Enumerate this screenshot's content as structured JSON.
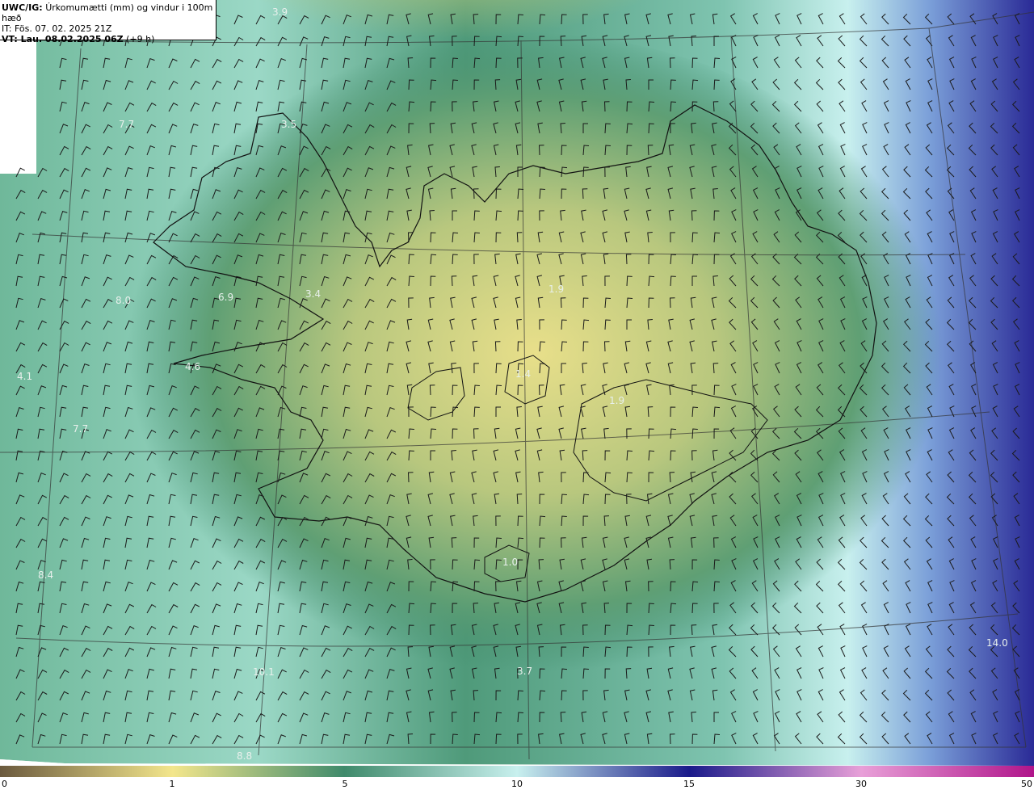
{
  "header": {
    "model": "UWC/IG:",
    "title": "Úrkomumætti (mm) og vindur i 100m hæð",
    "it_line": "IT: Fös. 07. 02. 2025 21Z",
    "vt_bold": "VT: Lau. 08.02.2025 06Z",
    "vt_offset": "(+9 h)"
  },
  "map_labels": [
    {
      "text": "3.9"
    },
    {
      "text": "7.7"
    },
    {
      "text": "3.5"
    },
    {
      "text": "8.0"
    },
    {
      "text": "6.9"
    },
    {
      "text": "3.4"
    },
    {
      "text": "4.1"
    },
    {
      "text": "4.6"
    },
    {
      "text": "7.7"
    },
    {
      "text": "1.9"
    },
    {
      "text": "1.4"
    },
    {
      "text": "1.9"
    },
    {
      "text": "8.4"
    },
    {
      "text": "1.0"
    },
    {
      "text": "10.1"
    },
    {
      "text": "3.7"
    },
    {
      "text": "14.0"
    },
    {
      "text": "8.8"
    }
  ],
  "colorbar": {
    "ticks": [
      "0",
      "1",
      "5",
      "10",
      "15",
      "30",
      "50"
    ],
    "colors": {
      "c0": "#6b5a3e",
      "c1": "#f3e68c",
      "c5": "#3f8a6b",
      "c10": "#c8f0ee",
      "c15": "#1a1a8a",
      "c30": "#e8a0d8",
      "c50": "#b0148a"
    }
  },
  "colors": {
    "sea_deep": "#2f2f9a",
    "sea_light": "#b8ecec",
    "land_low": "#3f8a6b",
    "land_high": "#e8df8a"
  }
}
